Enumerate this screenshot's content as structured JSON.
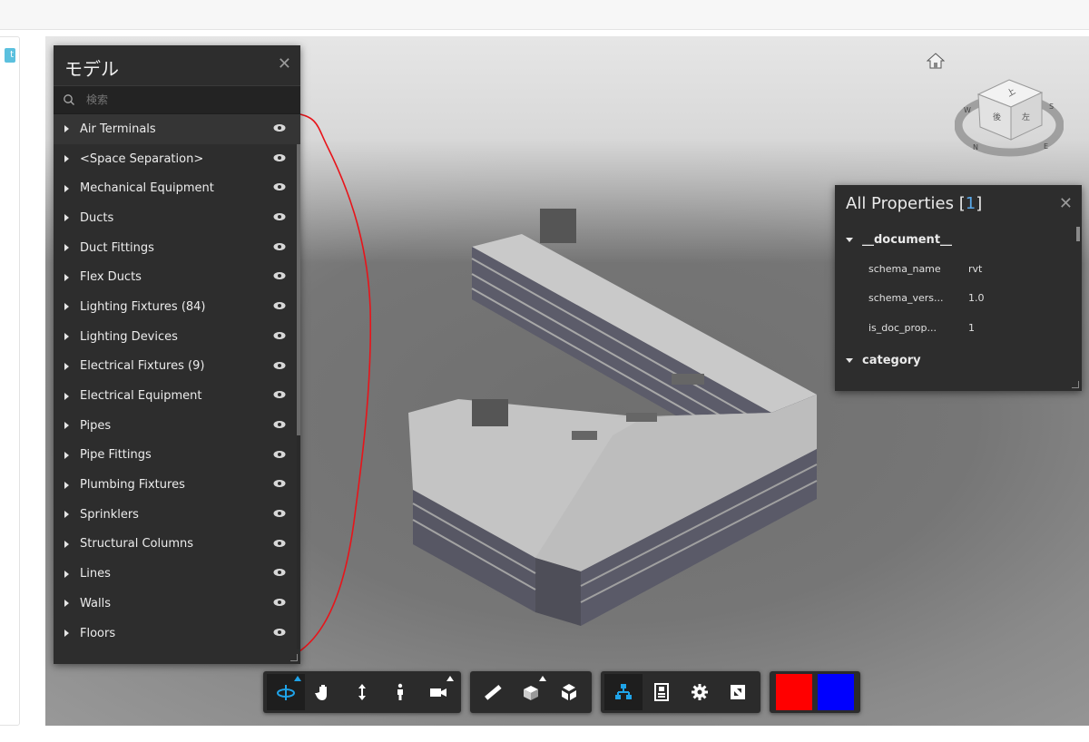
{
  "left_panel": {
    "badge_text": "t"
  },
  "model_browser": {
    "title": "モデル",
    "search_placeholder": "検索",
    "items": [
      {
        "label": "Air Terminals"
      },
      {
        "label": "<Space Separation>"
      },
      {
        "label": "Mechanical Equipment"
      },
      {
        "label": "Ducts"
      },
      {
        "label": "Duct Fittings"
      },
      {
        "label": "Flex Ducts"
      },
      {
        "label": "Lighting Fixtures (84)"
      },
      {
        "label": "Lighting Devices"
      },
      {
        "label": "Electrical Fixtures (9)"
      },
      {
        "label": "Electrical Equipment"
      },
      {
        "label": "Pipes"
      },
      {
        "label": "Pipe Fittings"
      },
      {
        "label": "Plumbing Fixtures"
      },
      {
        "label": "Sprinklers"
      },
      {
        "label": "Structural Columns"
      },
      {
        "label": "Lines"
      },
      {
        "label": "Walls"
      },
      {
        "label": "Floors"
      }
    ]
  },
  "properties": {
    "title": "All Properties",
    "count": "1",
    "sections": [
      {
        "name": "__document__",
        "rows": [
          {
            "key": "schema_name",
            "value": "rvt"
          },
          {
            "key": "schema_vers...",
            "value": "1.0"
          },
          {
            "key": "is_doc_prop...",
            "value": "1"
          }
        ]
      },
      {
        "name": "category"
      }
    ]
  },
  "viewcube": {
    "faces": [
      "上",
      "後",
      "左"
    ],
    "compass": [
      "W",
      "S",
      "N",
      "E"
    ]
  },
  "toolbar": {
    "groups": [
      [
        "orbit-icon",
        "pan-icon",
        "zoom-icon",
        "first-person-icon",
        "camera-icon"
      ],
      [
        "measure-icon",
        "section-icon",
        "explode-icon"
      ],
      [
        "model-browser-icon",
        "properties-icon",
        "settings-icon",
        "fullscreen-icon"
      ]
    ],
    "swatches": [
      "#ff0000",
      "#0000ff"
    ]
  },
  "colors": {
    "panel_bg": "#2d2d2d",
    "accent": "#1fa3e8",
    "annotation": "#e8141a"
  }
}
